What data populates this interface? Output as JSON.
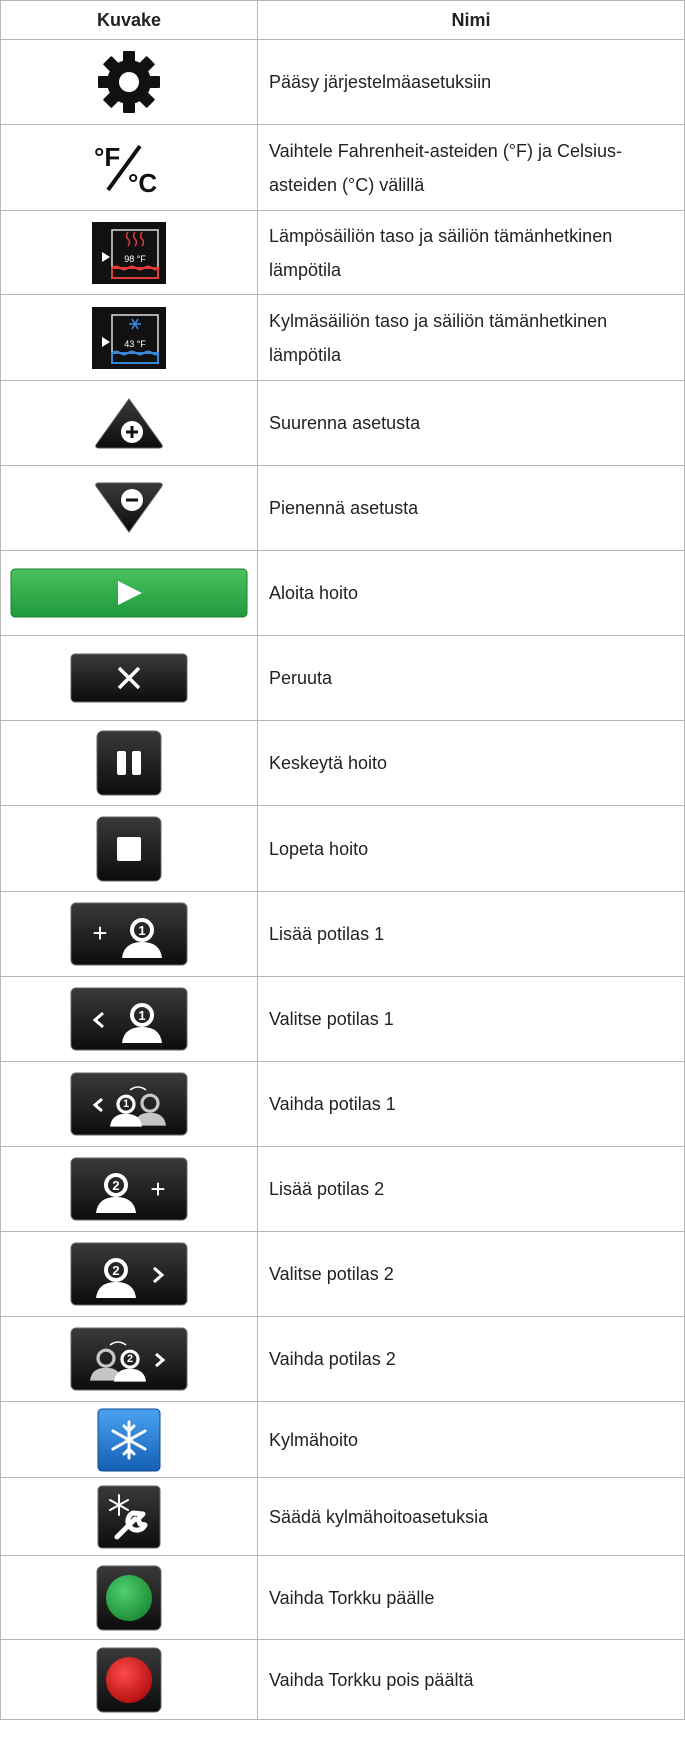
{
  "header": {
    "icon_col": "Kuvake",
    "name_col": "Nimi"
  },
  "rows": [
    {
      "icon": "gear-icon",
      "name": "Pääsy järjestelmäasetuksiin"
    },
    {
      "icon": "fahrenheit-celsius-icon",
      "icon_text": "°F/°C",
      "name": "Vaihtele Fahrenheit-asteiden (°F) ja Celsius-asteiden (°C) välillä"
    },
    {
      "icon": "heat-reservoir-icon",
      "icon_text": "98 °F",
      "name": "Lämpösäiliön taso ja säiliön tämänhetkinen lämpötila"
    },
    {
      "icon": "cold-reservoir-icon",
      "icon_text": "43 °F",
      "name": "Kylmäsäiliön taso ja säiliön tämänhetkinen lämpötila"
    },
    {
      "icon": "increase-triangle-icon",
      "name": "Suurenna asetusta"
    },
    {
      "icon": "decrease-triangle-icon",
      "name": "Pienennä asetusta"
    },
    {
      "icon": "start-play-button-icon",
      "name": "Aloita hoito"
    },
    {
      "icon": "cancel-x-button-icon",
      "name": "Peruuta"
    },
    {
      "icon": "pause-button-icon",
      "name": "Keskeytä hoito"
    },
    {
      "icon": "stop-button-icon",
      "name": "Lopeta hoito"
    },
    {
      "icon": "add-patient-1-icon",
      "name": "Lisää potilas 1"
    },
    {
      "icon": "select-patient-1-icon",
      "name": "Valitse potilas 1"
    },
    {
      "icon": "switch-patient-1-icon",
      "name": "Vaihda potilas 1"
    },
    {
      "icon": "add-patient-2-icon",
      "name": "Lisää potilas 2"
    },
    {
      "icon": "select-patient-2-icon",
      "name": "Valitse potilas 2"
    },
    {
      "icon": "switch-patient-2-icon",
      "name": "Vaihda potilas 2"
    },
    {
      "icon": "cold-therapy-snowflake-icon",
      "name": "Kylmähoito"
    },
    {
      "icon": "cold-therapy-settings-icon",
      "name": "Säädä kylmähoitoasetuksia"
    },
    {
      "icon": "snooze-on-green-icon",
      "name": "Vaihda Torkku päälle"
    },
    {
      "icon": "snooze-off-red-icon",
      "name": "Vaihda Torkku pois päältä"
    }
  ],
  "colors": {
    "button_dark": "#1a1a1a",
    "play_green": "#2fae4a",
    "snow_blue": "#1f6fc7",
    "heat_red": "#e03a3a",
    "cold_blue": "#3a86d6"
  }
}
